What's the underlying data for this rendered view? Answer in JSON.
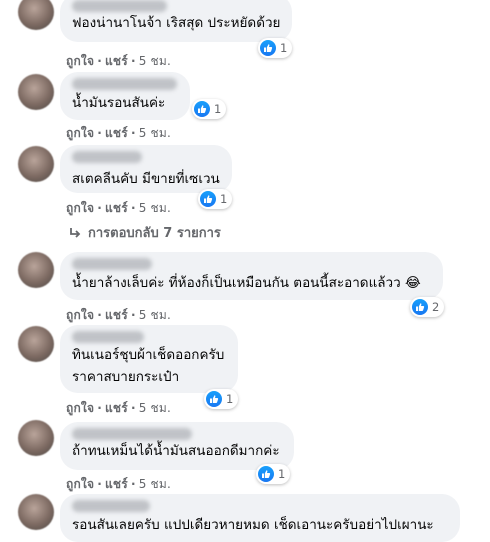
{
  "comments": [
    {
      "text": [
        "ฟองน่านาโนจ้า เริสสุด ประหยัดด้วย"
      ],
      "reactions": "1",
      "like": "ถูกใจ",
      "reply": "แชร์",
      "time": "5 ชม."
    },
    {
      "text": [
        "น้ำมันรอนสันค่ะ"
      ],
      "reactions": "1",
      "like": "ถูกใจ",
      "reply": "แชร์",
      "time": "5 ชม."
    },
    {
      "text": [
        "สเตคลีนคับ มีขายที่เซเวน"
      ],
      "reactions": "1",
      "like": "ถูกใจ",
      "reply": "แชร์",
      "time": "5 ชม."
    },
    {
      "text": [
        "น้ำยาล้างเล็บค่ะ ที่ห้องก็เป็นเหมือนกัน ตอนนี้สะอาดแล้วว 😂"
      ],
      "reactions": "2",
      "like": "ถูกใจ",
      "reply": "แชร์",
      "time": "5 ชม."
    },
    {
      "text": [
        "ทินเนอร์ชุบผ้าเช็ดออกครับ",
        "ราคาสบายกระเป๋า"
      ],
      "reactions": "1",
      "like": "ถูกใจ",
      "reply": "แชร์",
      "time": "5 ชม."
    },
    {
      "text": [
        "ถ้าทนเหม็นได้น้ำมันสนออกดีมากค่ะ"
      ],
      "reactions": "1",
      "like": "ถูกใจ",
      "reply": "แชร์",
      "time": "5 ชม."
    },
    {
      "text": [
        "รอนสันเลยครับ แปปเดียวหายหมด เช็ดเอานะครับอย่าไปเผานะ"
      ]
    }
  ],
  "view_replies": "การตอบกลับ 7 รายการ",
  "colors": {
    "bubble": "#f0f2f5",
    "like_blue": "#1877f2",
    "meta_gray": "#65676b"
  },
  "icons": {
    "like": "thumbs-up-icon",
    "haha": "haha-emoji-icon",
    "reply_arrow": "reply-arrow-icon"
  }
}
